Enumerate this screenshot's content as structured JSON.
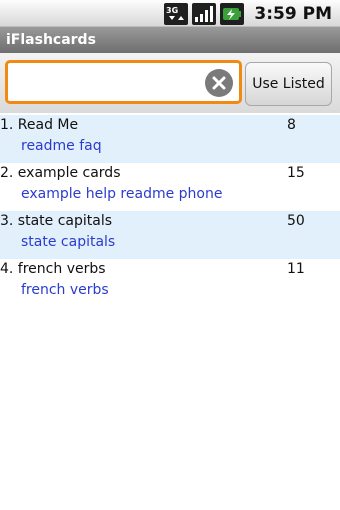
{
  "status_bar": {
    "icons": [
      "3g-data-icon",
      "signal-icon",
      "battery-charging-icon"
    ],
    "network_label": "3G",
    "time": "3:59 PM"
  },
  "app": {
    "title": "iFlashcards"
  },
  "search": {
    "value": "",
    "placeholder": "",
    "button_label": "Use Listed",
    "accent_color": "#f18a12"
  },
  "decks": [
    {
      "title": "1. Read Me",
      "tags": "readme faq",
      "count": "8"
    },
    {
      "title": "2. example cards",
      "tags": "example help readme phone",
      "count": "15"
    },
    {
      "title": "3. state capitals",
      "tags": "state capitals",
      "count": "50"
    },
    {
      "title": "4. french verbs",
      "tags": "french verbs",
      "count": "11"
    }
  ],
  "colors": {
    "alt_row": "#e2f0fb",
    "tag_link": "#2b3bd0"
  }
}
